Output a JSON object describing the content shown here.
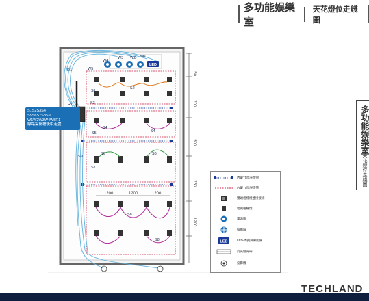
{
  "header": {
    "title": "多功能娱樂室",
    "subtitle": "天花燈位走綫圖"
  },
  "side_tab": {
    "title": "多功能娱樂室",
    "subtitle": "天花燈位走綫圖"
  },
  "callout": {
    "lines": [
      "S1S2S3S4",
      "S5S6S7S8S9",
      "W1W2W3W4W5R1",
      "線路需開槽後中走處"
    ]
  },
  "switch_labels": [
    "S1",
    "S2",
    "S3",
    "S4",
    "S5",
    "S6",
    "S7",
    "S8",
    "S9"
  ],
  "wall_labels": [
    "W1",
    "W2",
    "W3",
    "W4",
    "W5",
    "R1"
  ],
  "dimensions": [
    "1150",
    "1700",
    "1500",
    "1750",
    "1200"
  ],
  "spacing": [
    "1200",
    "1200",
    "1200"
  ],
  "legend": {
    "items": [
      "內藏T5暗光燈管",
      "內藏T5暗光燈管",
      "雙頭格柵燈連接接線",
      "暗藏格柵燈",
      "電源箱",
      "排風扇",
      "LED-內藏屏幕開關",
      "反光燈光帶",
      "投影機"
    ],
    "led_label": "LED"
  },
  "brand": "TECHLAND",
  "colors": {
    "accent": "#1a6fb5",
    "wire_red": "#cc2244",
    "wire_orange": "#e07a1a",
    "wire_green": "#2a9a3a",
    "wire_purple": "#b0279a",
    "wire_cyan": "#6bb8e0",
    "bar": "#0d1f3c"
  }
}
